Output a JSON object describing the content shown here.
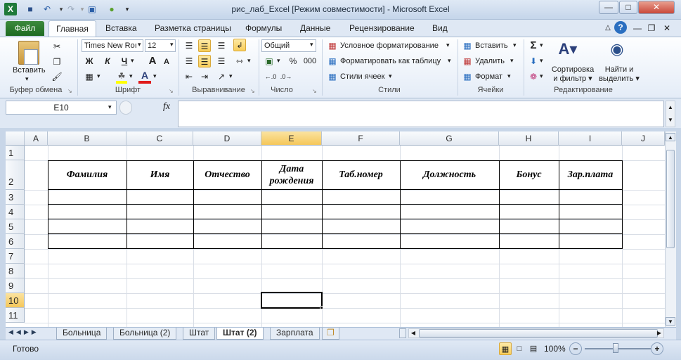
{
  "window": {
    "title": "рис_лаб_Excel  [Режим совместимости]  -  Microsoft Excel"
  },
  "ribbon_tabs": {
    "file": "Файл",
    "home": "Главная",
    "insert": "Вставка",
    "page_layout": "Разметка страницы",
    "formulas": "Формулы",
    "data": "Данные",
    "review": "Рецензирование",
    "view": "Вид"
  },
  "clipboard": {
    "paste": "Вставить",
    "label": "Буфер обмена"
  },
  "font": {
    "name": "Times New Roı",
    "size": "12",
    "bold": "Ж",
    "italic": "К",
    "underline": "Ч",
    "grow": "A",
    "shrink": "A",
    "color_letter": "A",
    "label": "Шрифт"
  },
  "alignment": {
    "label": "Выравнивание"
  },
  "number": {
    "format": "Общий",
    "percent": "%",
    "thousands": "000",
    "label": "Число"
  },
  "styles": {
    "conditional": "Условное форматирование",
    "as_table": "Форматировать как таблицу",
    "cell_styles": "Стили ячеек",
    "label": "Стили"
  },
  "cells": {
    "insert": "Вставить",
    "delete": "Удалить",
    "format": "Формат",
    "label": "Ячейки"
  },
  "editing": {
    "sum": "Σ",
    "sort_line1": "Сортировка",
    "sort_line2": "и фильтр",
    "find_line1": "Найти и",
    "find_line2": "выделить",
    "label": "Редактирование"
  },
  "formula_bar": {
    "name_box": "E10",
    "fx": "fx",
    "formula": ""
  },
  "columns": [
    "A",
    "B",
    "C",
    "D",
    "E",
    "F",
    "G",
    "H",
    "I",
    "J"
  ],
  "rows": [
    "1",
    "2",
    "3",
    "4",
    "5",
    "6",
    "7",
    "8",
    "9",
    "10",
    "11"
  ],
  "table_headers": {
    "b": "Фамилия",
    "c": "Имя",
    "d": "Отчество",
    "e1": "Дата",
    "e2": "рождения",
    "f": "Таб.номер",
    "g": "Должность",
    "h": "Бонус",
    "i": "Зар.плата"
  },
  "sheets": [
    "Больница",
    "Больница (2)",
    "Штат",
    "Штат (2)",
    "Зарплата"
  ],
  "status": {
    "ready": "Готово",
    "zoom": "100%",
    "minus": "−",
    "plus": "+"
  },
  "colors": {
    "file_tab": "#217821",
    "selection": "#f8cd5a"
  }
}
